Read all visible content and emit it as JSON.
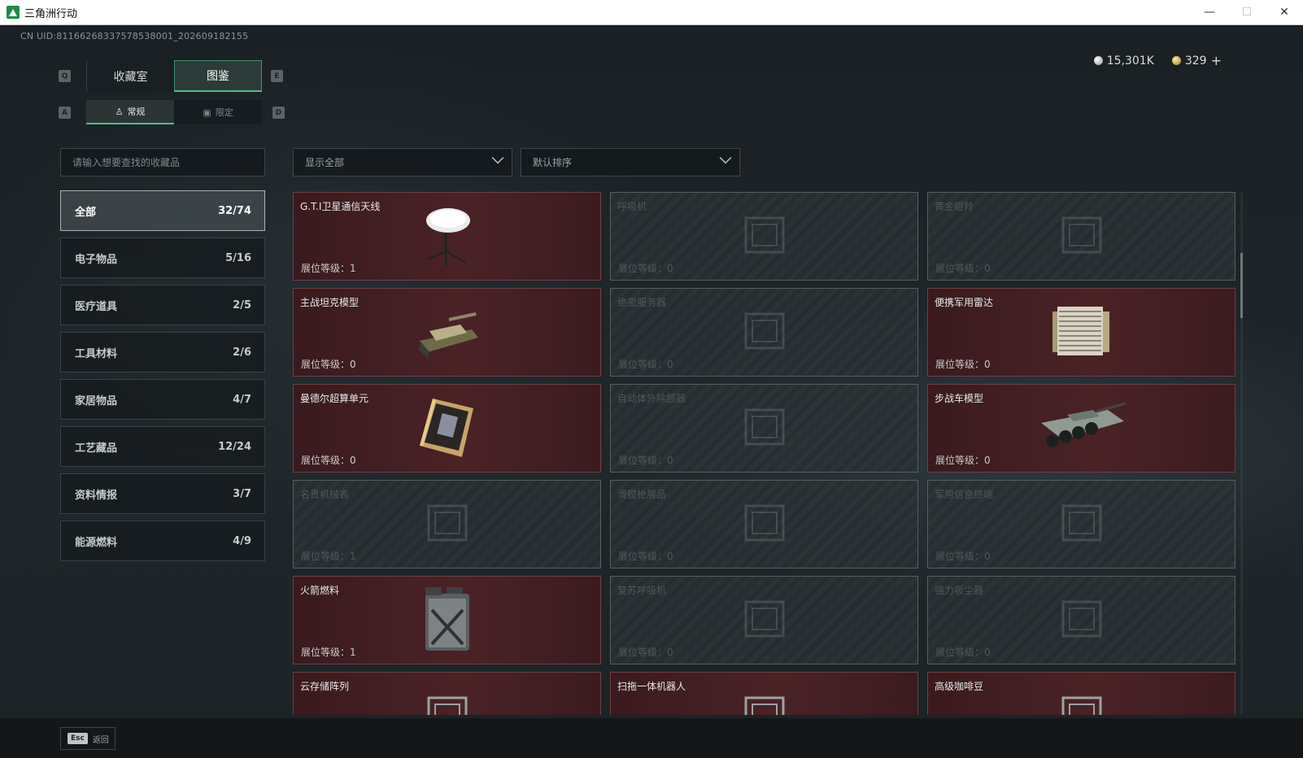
{
  "window": {
    "title": "三角洲行动",
    "minimize": "—",
    "maximize": "☐",
    "close": "✕"
  },
  "uid": "CN UID:811662683375785380​01_202609182155",
  "currency": {
    "silver": "15,301K",
    "gold": "329",
    "add": "+"
  },
  "keys": {
    "prev_tab": "Q",
    "next_tab": "E",
    "prev_sub": "A",
    "next_sub": "D"
  },
  "tabs_main": [
    {
      "label": "收藏室"
    },
    {
      "label": "图鉴"
    }
  ],
  "tabs_sub": [
    {
      "label": "常规"
    },
    {
      "label": "限定"
    }
  ],
  "search": {
    "placeholder": "请输入想要查找的收藏品"
  },
  "filter": {
    "value": "显示全部"
  },
  "sort": {
    "value": "默认排序"
  },
  "categories": [
    {
      "label": "全部",
      "count": "32/74"
    },
    {
      "label": "电子物品",
      "count": "5/16"
    },
    {
      "label": "医疗道具",
      "count": "2/5"
    },
    {
      "label": "工具材料",
      "count": "2/6"
    },
    {
      "label": "家居物品",
      "count": "4/7"
    },
    {
      "label": "工艺藏品",
      "count": "12/24"
    },
    {
      "label": "资料情报",
      "count": "3/7"
    },
    {
      "label": "能源燃料",
      "count": "4/9"
    }
  ],
  "items": [
    {
      "name": "G.T.I卫星通信天线",
      "level": "展位等级：1",
      "owned": true,
      "icon": "satellite-dish-icon"
    },
    {
      "name": "呼吸机",
      "level": "展位等级：0",
      "owned": false,
      "icon": "ventilator-icon"
    },
    {
      "name": "黄金瞪羚",
      "level": "展位等级：0",
      "owned": false,
      "icon": "gazelle-statue-icon"
    },
    {
      "name": "主战坦克模型",
      "level": "展位等级：0",
      "owned": true,
      "icon": "tank-model-icon"
    },
    {
      "name": "绝密服务器",
      "level": "展位等级：0",
      "owned": false,
      "icon": "server-icon"
    },
    {
      "name": "便携军用雷达",
      "level": "展位等级：0",
      "owned": true,
      "icon": "radar-icon"
    },
    {
      "name": "曼德尔超算单元",
      "level": "展位等级：0",
      "owned": true,
      "icon": "compute-unit-icon"
    },
    {
      "name": "自动体外除颤器",
      "level": "展位等级：0",
      "owned": false,
      "icon": "defibrillator-icon"
    },
    {
      "name": "步战车模型",
      "level": "展位等级：0",
      "owned": true,
      "icon": "ifv-model-icon"
    },
    {
      "name": "名贵机械表",
      "level": "展位等级：1",
      "owned": false,
      "icon": "watch-icon"
    },
    {
      "name": "滑膛枪展品",
      "level": "展位等级：0",
      "owned": false,
      "icon": "musket-icon"
    },
    {
      "name": "军用信息终端",
      "level": "展位等级：0",
      "owned": false,
      "icon": "terminal-icon"
    },
    {
      "name": "火箭燃料",
      "level": "展位等级：1",
      "owned": true,
      "icon": "fuel-can-icon"
    },
    {
      "name": "复苏呼吸机",
      "level": "展位等级：0",
      "owned": false,
      "icon": "resuscitator-icon"
    },
    {
      "name": "强力吸尘器",
      "level": "展位等级：0",
      "owned": false,
      "icon": "vacuum-icon"
    },
    {
      "name": "云存储阵列",
      "level": "",
      "owned": true,
      "icon": "storage-array-icon"
    },
    {
      "name": "扫拖一体机器人",
      "level": "",
      "owned": true,
      "icon": "robot-vacuum-icon"
    },
    {
      "name": "高级咖啡豆",
      "level": "",
      "owned": true,
      "icon": "coffee-icon"
    }
  ],
  "footer": {
    "esc_key": "Esc",
    "back_label": "返回"
  }
}
